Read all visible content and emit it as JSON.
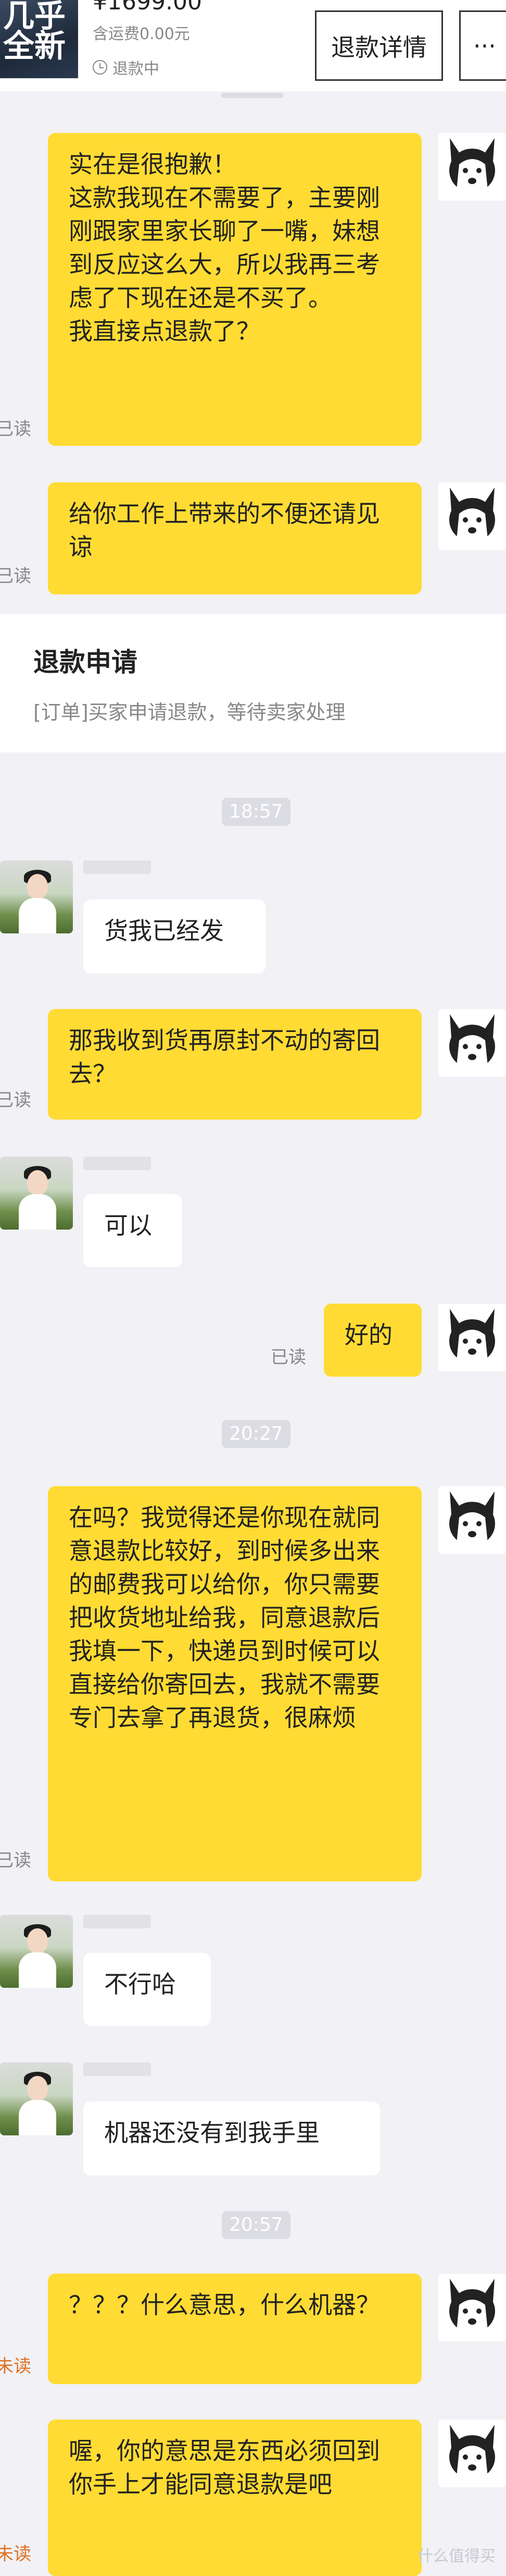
{
  "header": {
    "thumb_line1": "几乎",
    "thumb_line2": "全新",
    "price": "¥1699.00",
    "shipping": "含运费0.00元",
    "status": "退款中",
    "refund_detail_button": "退款详情",
    "more_button": "···"
  },
  "read_label": "已读",
  "unread_label": "未读",
  "messages": {
    "m1": "实在是很抱歉！\n这款我现在不需要了，主要刚刚跟家里家长聊了一嘴，妹想到反应这么大，所以我再三考虑了下现在还是不买了。\n我直接点退款了？",
    "m2": "给你工作上带来的不便还请见谅",
    "m3": "货我已经发",
    "m4": "那我收到货再原封不动的寄回去？",
    "m5": "可以",
    "m6": "好的",
    "m7": "在吗？我觉得还是你现在就同意退款比较好，到时候多出来的邮费我可以给你，你只需要把收货地址给我，同意退款后我填一下，快递员到时候可以直接给你寄回去，我就不需要专门去拿了再退货，很麻烦",
    "m8": "不行哈",
    "m9": "机器还没有到我手里",
    "m10": "？？？什么意思，什么机器？",
    "m11": "喔，你的意思是东西必须回到你手上才能同意退款是吧"
  },
  "system": {
    "title": "退款申请",
    "desc": "[订单]买家申请退款，等待卖家处理"
  },
  "times": {
    "t1": "18:57",
    "t2": "20:27",
    "t3": "20:57"
  },
  "watermark": "什么值得买"
}
